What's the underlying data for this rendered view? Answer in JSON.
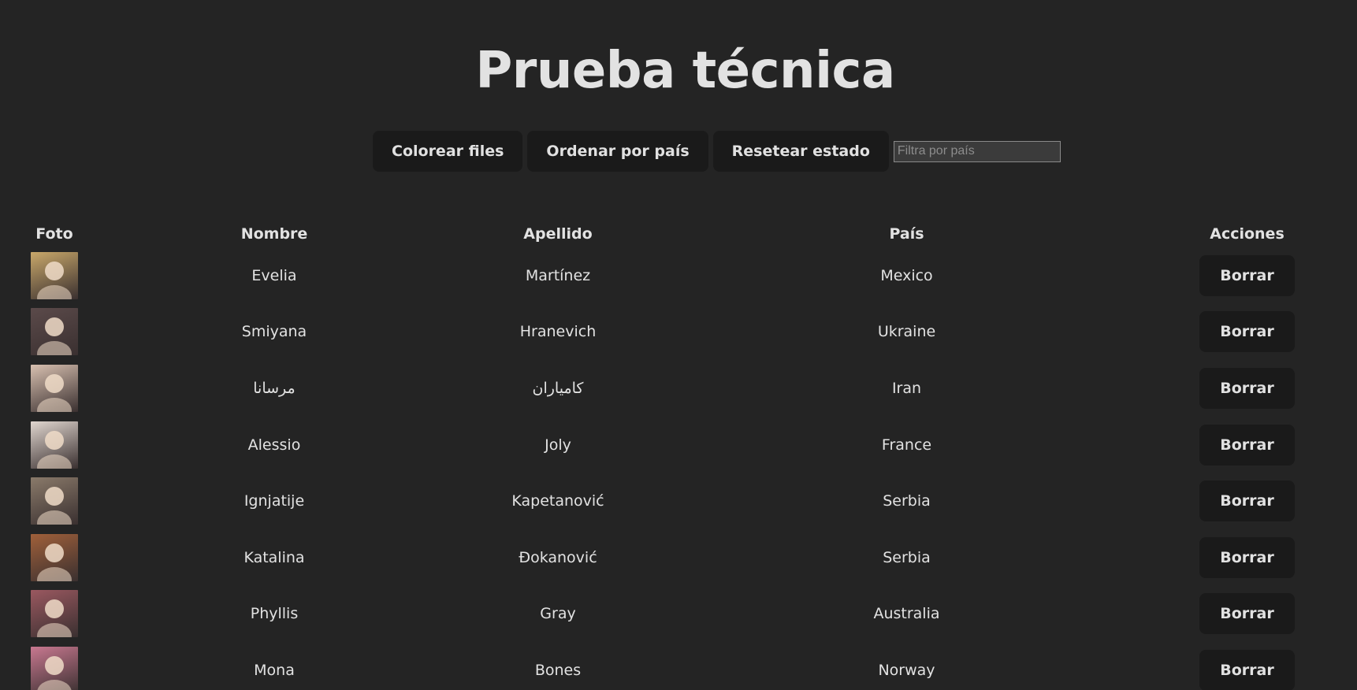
{
  "title": "Prueba técnica",
  "toolbar": {
    "color_rows_label": "Colorear files",
    "sort_country_label": "Ordenar por país",
    "reset_label": "Resetear estado",
    "filter_placeholder": "Filtra por país",
    "filter_value": ""
  },
  "table": {
    "headers": [
      "Foto",
      "Nombre",
      "Apellido",
      "País",
      "Acciones"
    ],
    "delete_label": "Borrar",
    "rows": [
      {
        "first": "Evelia",
        "last": "Martínez",
        "country": "Mexico",
        "photo_icon": "user-photo",
        "photo_color": "#c9a86a"
      },
      {
        "first": "Smiyana",
        "last": "Hranevich",
        "country": "Ukraine",
        "photo_icon": "user-photo",
        "photo_color": "#5b4a4a"
      },
      {
        "first": "مرسانا",
        "last": "کامیاران",
        "country": "Iran",
        "photo_icon": "user-photo",
        "photo_color": "#d8c0b0"
      },
      {
        "first": "Alessio",
        "last": "Joly",
        "country": "France",
        "photo_icon": "user-photo",
        "photo_color": "#e0d6cf"
      },
      {
        "first": "Ignjatije",
        "last": "Kapetanović",
        "country": "Serbia",
        "photo_icon": "user-photo",
        "photo_color": "#8a7a6a"
      },
      {
        "first": "Katalina",
        "last": "Đokanović",
        "country": "Serbia",
        "photo_icon": "user-photo",
        "photo_color": "#a0603a"
      },
      {
        "first": "Phyllis",
        "last": "Gray",
        "country": "Australia",
        "photo_icon": "user-photo",
        "photo_color": "#9a5860"
      },
      {
        "first": "Mona",
        "last": "Bones",
        "country": "Norway",
        "photo_icon": "user-photo",
        "photo_color": "#c87890"
      }
    ]
  }
}
